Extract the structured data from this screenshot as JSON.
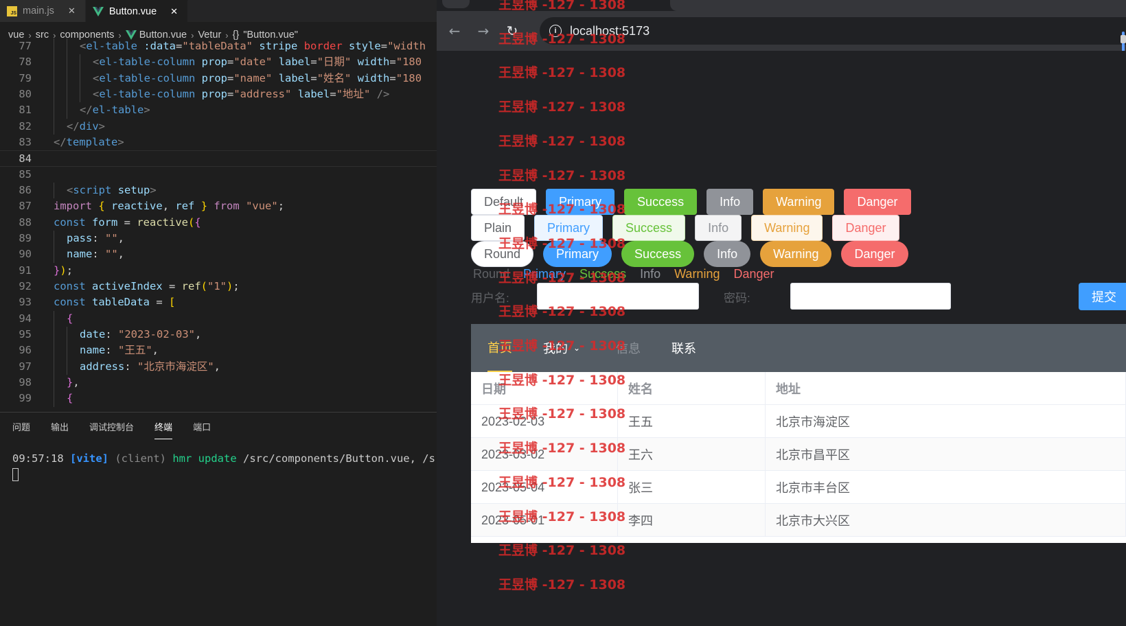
{
  "editor": {
    "tabs": [
      {
        "label": "main.js",
        "icon": "js-file-icon",
        "active": false
      },
      {
        "label": "Button.vue",
        "icon": "vue-file-icon",
        "active": true
      }
    ],
    "breadcrumb": {
      "items": [
        "vue",
        "src",
        "components",
        "Button.vue",
        "Vetur"
      ],
      "symbol": "\"Button.vue\""
    },
    "code_lines": [
      {
        "num": "77",
        "indent": 2,
        "tokens": [
          [
            "tk-punc",
            "<"
          ],
          [
            "tk-tag",
            "el-table"
          ],
          [
            "tk-text",
            " "
          ],
          [
            "tk-attr",
            ":data"
          ],
          [
            "tk-text",
            "="
          ],
          [
            "tk-str",
            "\"tableData\""
          ],
          [
            "tk-text",
            " "
          ],
          [
            "tk-attr",
            "stripe"
          ],
          [
            "tk-text",
            " "
          ],
          [
            "tk-red",
            "border"
          ],
          [
            "tk-text",
            " "
          ],
          [
            "tk-attr",
            "style"
          ],
          [
            "tk-text",
            "="
          ],
          [
            "tk-str",
            "\"width"
          ]
        ]
      },
      {
        "num": "78",
        "indent": 3,
        "tokens": [
          [
            "tk-punc",
            "<"
          ],
          [
            "tk-tag",
            "el-table-column"
          ],
          [
            "tk-text",
            " "
          ],
          [
            "tk-attr",
            "prop"
          ],
          [
            "tk-text",
            "="
          ],
          [
            "tk-str",
            "\"date\""
          ],
          [
            "tk-text",
            " "
          ],
          [
            "tk-attr",
            "label"
          ],
          [
            "tk-text",
            "="
          ],
          [
            "tk-str",
            "\"日期\""
          ],
          [
            "tk-text",
            " "
          ],
          [
            "tk-attr",
            "width"
          ],
          [
            "tk-text",
            "="
          ],
          [
            "tk-str",
            "\"180"
          ]
        ]
      },
      {
        "num": "79",
        "indent": 3,
        "tokens": [
          [
            "tk-punc",
            "<"
          ],
          [
            "tk-tag",
            "el-table-column"
          ],
          [
            "tk-text",
            " "
          ],
          [
            "tk-attr",
            "prop"
          ],
          [
            "tk-text",
            "="
          ],
          [
            "tk-str",
            "\"name\""
          ],
          [
            "tk-text",
            " "
          ],
          [
            "tk-attr",
            "label"
          ],
          [
            "tk-text",
            "="
          ],
          [
            "tk-str",
            "\"姓名\""
          ],
          [
            "tk-text",
            " "
          ],
          [
            "tk-attr",
            "width"
          ],
          [
            "tk-text",
            "="
          ],
          [
            "tk-str",
            "\"180"
          ]
        ]
      },
      {
        "num": "80",
        "indent": 3,
        "tokens": [
          [
            "tk-punc",
            "<"
          ],
          [
            "tk-tag",
            "el-table-column"
          ],
          [
            "tk-text",
            " "
          ],
          [
            "tk-attr",
            "prop"
          ],
          [
            "tk-text",
            "="
          ],
          [
            "tk-str",
            "\"address\""
          ],
          [
            "tk-text",
            " "
          ],
          [
            "tk-attr",
            "label"
          ],
          [
            "tk-text",
            "="
          ],
          [
            "tk-str",
            "\"地址\""
          ],
          [
            "tk-text",
            " "
          ],
          [
            "tk-punc",
            "/>"
          ]
        ]
      },
      {
        "num": "81",
        "indent": 2,
        "tokens": [
          [
            "tk-punc",
            "</"
          ],
          [
            "tk-tag",
            "el-table"
          ],
          [
            "tk-punc",
            ">"
          ]
        ]
      },
      {
        "num": "82",
        "indent": 1,
        "tokens": [
          [
            "tk-punc",
            "</"
          ],
          [
            "tk-tag",
            "div"
          ],
          [
            "tk-punc",
            ">"
          ]
        ]
      },
      {
        "num": "83",
        "indent": 0,
        "tokens": [
          [
            "tk-punc",
            "</"
          ],
          [
            "tk-tag",
            "template"
          ],
          [
            "tk-punc",
            ">"
          ]
        ]
      },
      {
        "num": "84",
        "indent": 0,
        "tokens": [],
        "current": true
      },
      {
        "num": "85",
        "indent": 0,
        "tokens": []
      },
      {
        "num": "86",
        "indent": 1,
        "tokens": [
          [
            "tk-punc",
            "<"
          ],
          [
            "tk-tag",
            "script"
          ],
          [
            "tk-text",
            " "
          ],
          [
            "tk-attr",
            "setup"
          ],
          [
            "tk-punc",
            ">"
          ]
        ]
      },
      {
        "num": "87",
        "indent": 0,
        "tokens": [
          [
            "tk-kw",
            "import"
          ],
          [
            "tk-text",
            " "
          ],
          [
            "tk-brace",
            "{"
          ],
          [
            "tk-text",
            " "
          ],
          [
            "tk-var",
            "reactive"
          ],
          [
            "tk-text",
            ", "
          ],
          [
            "tk-var",
            "ref"
          ],
          [
            "tk-text",
            " "
          ],
          [
            "tk-brace",
            "}"
          ],
          [
            "tk-text",
            " "
          ],
          [
            "tk-kw",
            "from"
          ],
          [
            "tk-text",
            " "
          ],
          [
            "tk-str",
            "\"vue\""
          ],
          [
            "tk-text",
            ";"
          ]
        ]
      },
      {
        "num": "88",
        "indent": 0,
        "tokens": [
          [
            "tk-decl",
            "const"
          ],
          [
            "tk-text",
            " "
          ],
          [
            "tk-var",
            "form"
          ],
          [
            "tk-text",
            " = "
          ],
          [
            "tk-fn",
            "reactive"
          ],
          [
            "tk-brace",
            "("
          ],
          [
            "tk-brace2",
            "{"
          ]
        ]
      },
      {
        "num": "89",
        "indent": 1,
        "tokens": [
          [
            "tk-var",
            "pass"
          ],
          [
            "tk-text",
            ": "
          ],
          [
            "tk-str",
            "\"\""
          ],
          [
            "tk-text",
            ","
          ]
        ]
      },
      {
        "num": "90",
        "indent": 1,
        "tokens": [
          [
            "tk-var",
            "name"
          ],
          [
            "tk-text",
            ": "
          ],
          [
            "tk-str",
            "\"\""
          ],
          [
            "tk-text",
            ","
          ]
        ]
      },
      {
        "num": "91",
        "indent": 0,
        "tokens": [
          [
            "tk-brace2",
            "}"
          ],
          [
            "tk-brace",
            ")"
          ],
          [
            "tk-text",
            ";"
          ]
        ]
      },
      {
        "num": "92",
        "indent": 0,
        "tokens": [
          [
            "tk-decl",
            "const"
          ],
          [
            "tk-text",
            " "
          ],
          [
            "tk-var",
            "activeIndex"
          ],
          [
            "tk-text",
            " = "
          ],
          [
            "tk-fn",
            "ref"
          ],
          [
            "tk-brace",
            "("
          ],
          [
            "tk-str",
            "\"1\""
          ],
          [
            "tk-brace",
            ")"
          ],
          [
            "tk-text",
            ";"
          ]
        ]
      },
      {
        "num": "93",
        "indent": 0,
        "tokens": [
          [
            "tk-decl",
            "const"
          ],
          [
            "tk-text",
            " "
          ],
          [
            "tk-var",
            "tableData"
          ],
          [
            "tk-text",
            " = "
          ],
          [
            "tk-brace",
            "["
          ]
        ]
      },
      {
        "num": "94",
        "indent": 1,
        "tokens": [
          [
            "tk-brace2",
            "{"
          ]
        ]
      },
      {
        "num": "95",
        "indent": 2,
        "tokens": [
          [
            "tk-var",
            "date"
          ],
          [
            "tk-text",
            ": "
          ],
          [
            "tk-str",
            "\"2023-02-03\""
          ],
          [
            "tk-text",
            ","
          ]
        ]
      },
      {
        "num": "96",
        "indent": 2,
        "tokens": [
          [
            "tk-var",
            "name"
          ],
          [
            "tk-text",
            ": "
          ],
          [
            "tk-str",
            "\"王五\""
          ],
          [
            "tk-text",
            ","
          ]
        ]
      },
      {
        "num": "97",
        "indent": 2,
        "tokens": [
          [
            "tk-var",
            "address"
          ],
          [
            "tk-text",
            ": "
          ],
          [
            "tk-str",
            "\"北京市海淀区\""
          ],
          [
            "tk-text",
            ","
          ]
        ]
      },
      {
        "num": "98",
        "indent": 1,
        "tokens": [
          [
            "tk-brace2",
            "}"
          ],
          [
            "tk-text",
            ","
          ]
        ]
      },
      {
        "num": "99",
        "indent": 1,
        "tokens": [
          [
            "tk-brace2",
            "{"
          ]
        ]
      }
    ],
    "panel": {
      "tabs": [
        "问题",
        "输出",
        "调试控制台",
        "终端",
        "端口"
      ],
      "active_tab": "终端",
      "terminal": {
        "time": "09:57:18",
        "tag": "[vite]",
        "client": "(client)",
        "action": "hmr update",
        "path": "/src/components/Button.vue, /src/"
      }
    }
  },
  "browser": {
    "url": "localhost:5173",
    "buttons": {
      "row1": [
        {
          "label": "Default",
          "type": "default"
        },
        {
          "label": "Primary",
          "type": "primary"
        },
        {
          "label": "Success",
          "type": "success"
        },
        {
          "label": "Info",
          "type": "info"
        },
        {
          "label": "Warning",
          "type": "warning"
        },
        {
          "label": "Danger",
          "type": "danger"
        }
      ],
      "row2": [
        {
          "label": "Plain",
          "type": "default"
        },
        {
          "label": "Primary",
          "type": "primary"
        },
        {
          "label": "Success",
          "type": "success"
        },
        {
          "label": "Info",
          "type": "info"
        },
        {
          "label": "Warning",
          "type": "warning"
        },
        {
          "label": "Danger",
          "type": "danger"
        }
      ],
      "row3": [
        {
          "label": "Round",
          "type": "default"
        },
        {
          "label": "Primary",
          "type": "primary"
        },
        {
          "label": "Success",
          "type": "success"
        },
        {
          "label": "Info",
          "type": "info"
        },
        {
          "label": "Warning",
          "type": "warning"
        },
        {
          "label": "Danger",
          "type": "danger"
        }
      ],
      "text_row": [
        {
          "label": "Round",
          "type": "default"
        },
        {
          "label": "Primary",
          "type": "primary"
        },
        {
          "label": "Success",
          "type": "success"
        },
        {
          "label": "Info",
          "type": "info"
        },
        {
          "label": "Warning",
          "type": "warning"
        },
        {
          "label": "Danger",
          "type": "danger"
        }
      ]
    },
    "form": {
      "username_label": "用户名:",
      "username_value": "",
      "password_label": "密码:",
      "password_value": "",
      "submit_label": "提交"
    },
    "menu": {
      "items": [
        {
          "label": "首页",
          "state": "active"
        },
        {
          "label": "我的",
          "state": "submenu"
        },
        {
          "label": "信息",
          "state": "disabled"
        },
        {
          "label": "联系",
          "state": "normal"
        }
      ]
    },
    "table": {
      "headers": [
        "日期",
        "姓名",
        "地址"
      ],
      "rows": [
        [
          "2023-02-03",
          "王五",
          "北京市海淀区"
        ],
        [
          "2023-03-02",
          "王六",
          "北京市昌平区"
        ],
        [
          "2023-05-04",
          "张三",
          "北京市丰台区"
        ],
        [
          "2023-05-01",
          "李四",
          "北京市大兴区"
        ]
      ]
    },
    "watermark": "王昱博 -127 - 1308"
  },
  "colors": {
    "primary": "#409eff",
    "success": "#67c23a",
    "info": "#909399",
    "warning": "#e6a23c",
    "danger": "#f56c6c",
    "menu_bg": "#545c64",
    "menu_active": "#ffd04b"
  }
}
